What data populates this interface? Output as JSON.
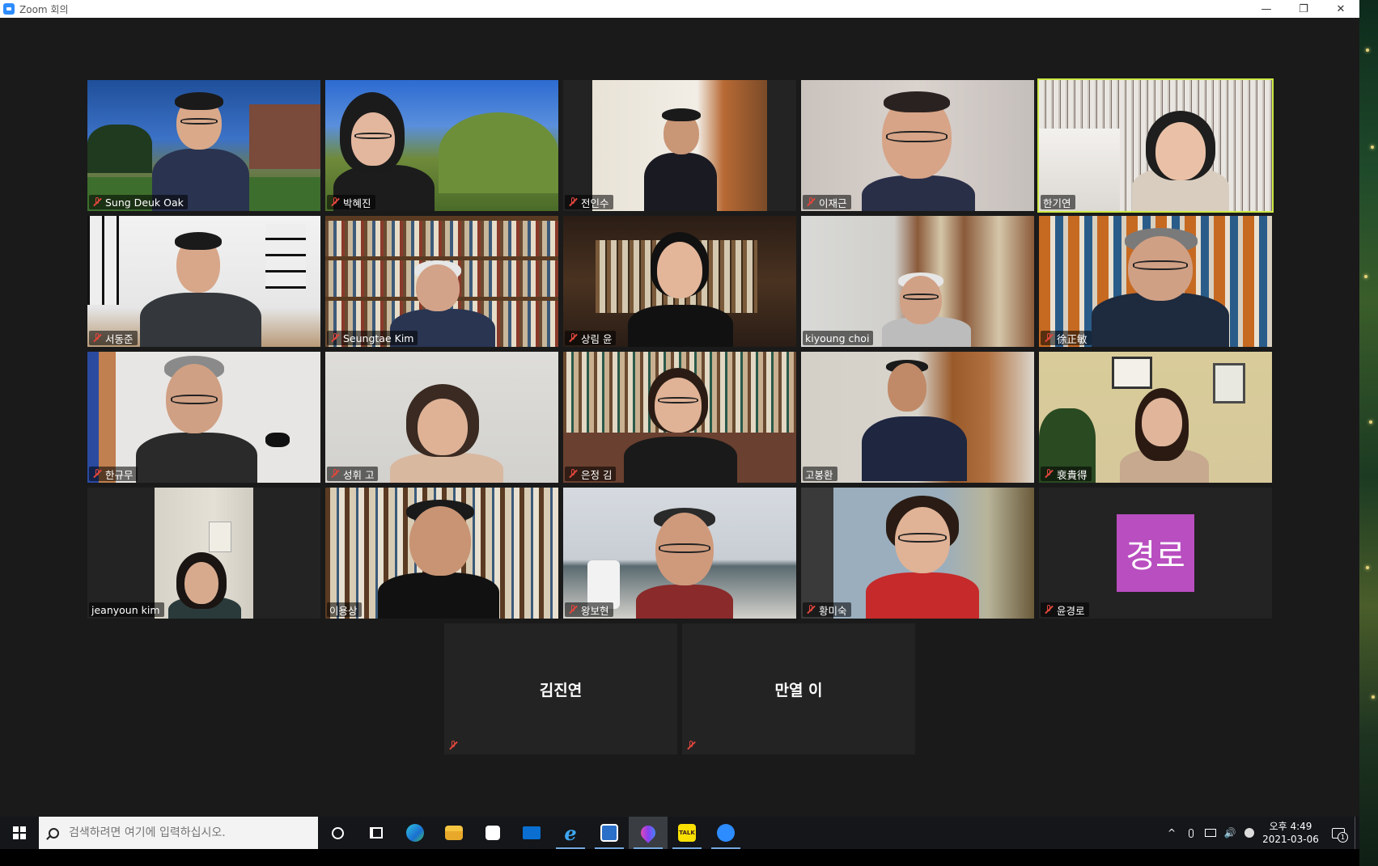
{
  "window": {
    "title": "Zoom 회의",
    "min_glyph": "—",
    "restore_glyph": "❐",
    "close_glyph": "✕"
  },
  "colors": {
    "active_speaker_border": "#cbe845",
    "mute_red": "#e0463c",
    "avatar_purple": "#b94ec0",
    "meeting_bg": "#1a1a1a"
  },
  "participants": [
    {
      "name": "Sung Deuk Oak",
      "muted": true
    },
    {
      "name": "박혜진",
      "muted": true
    },
    {
      "name": "전인수",
      "muted": true
    },
    {
      "name": "이재근",
      "muted": true
    },
    {
      "name": "한기연",
      "muted": false,
      "active_speaker": true
    },
    {
      "name": "서동준",
      "muted": true
    },
    {
      "name": "Seungtae Kim",
      "muted": true
    },
    {
      "name": "상림 윤",
      "muted": true
    },
    {
      "name": "kiyoung choi",
      "muted": false
    },
    {
      "name": "徐正敏",
      "muted": true
    },
    {
      "name": "한규무",
      "muted": true
    },
    {
      "name": "성휘 고",
      "muted": true
    },
    {
      "name": "은정 김",
      "muted": true
    },
    {
      "name": "고봉환",
      "muted": false
    },
    {
      "name": "裵貴得",
      "muted": true
    },
    {
      "name": "jeanyoun kim",
      "muted": false
    },
    {
      "name": "이용상",
      "muted": false
    },
    {
      "name": "왕보현",
      "muted": true
    },
    {
      "name": "황미숙",
      "muted": true
    },
    {
      "name": "윤경로",
      "muted": true,
      "avatar_text": "경로"
    },
    {
      "name": "김진연",
      "muted": true,
      "video_off": true
    },
    {
      "name": "만열 이",
      "muted": true,
      "video_off": true
    }
  ],
  "taskbar": {
    "search_placeholder": "검색하려면 여기에 입력하십시오.",
    "apps": [
      "cortana-icon",
      "task-view-icon",
      "edge-icon",
      "file-explorer-icon",
      "store-icon",
      "mail-icon",
      "ie-icon",
      "hancom-icon",
      "paint-icon",
      "kakaotalk-icon",
      "zoom-icon"
    ],
    "kakaotalk_label": "TALK",
    "clock_time": "오후 4:49",
    "clock_date": "2021-03-06",
    "notification_count": "1",
    "tray_glyphs": {
      "chevron": "^",
      "volume": "🔊"
    }
  }
}
